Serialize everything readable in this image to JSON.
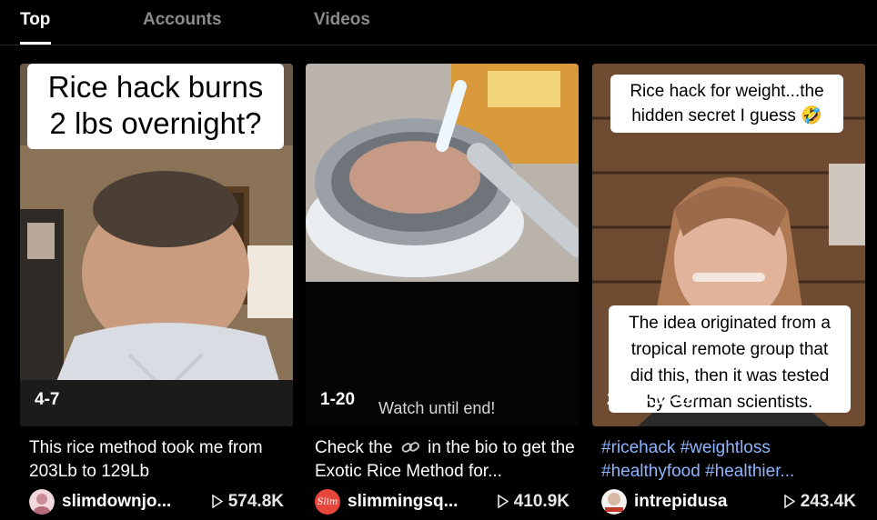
{
  "tabs": [
    {
      "label": "Top",
      "active": true
    },
    {
      "label": "Accounts",
      "active": false
    },
    {
      "label": "Videos",
      "active": false
    }
  ],
  "cards": [
    {
      "caption_lines": [
        "Rice hack burns",
        "2 lbs overnight?"
      ],
      "date": "4-7",
      "description": "This rice method took me from 203Lb to 129Lb",
      "username": "slimdownjo...",
      "views": "574.8K",
      "avatar_icon": "avatar-pink"
    },
    {
      "watch_label": "Watch until end!",
      "date": "1-20",
      "description_part1": "Check the",
      "link_icon": "link-icon",
      "description_part2": "in the bio to get the Exotic Rice Method for...",
      "username": "slimmingsq...",
      "views": "410.9K",
      "avatar_text": "Slim",
      "accent_color": "#e8463c"
    },
    {
      "caption_top_lines": [
        "Rice hack for weight...the",
        "hidden secret I guess 🤣"
      ],
      "caption_bottom_lines": [
        "The idea originated from a",
        "tropical remote group that",
        "did this, then it was tested",
        "by German scientists."
      ],
      "date": "2023-12-19",
      "description": "#ricehack #weightloss #healthyfood #healthier...",
      "username": "intrepidusa",
      "views": "243.4K",
      "hashtag_color": "#8db4ff"
    }
  ],
  "colors": {
    "background": "#000000",
    "tab_inactive": "#8a8a8a",
    "text": "#ffffff"
  }
}
